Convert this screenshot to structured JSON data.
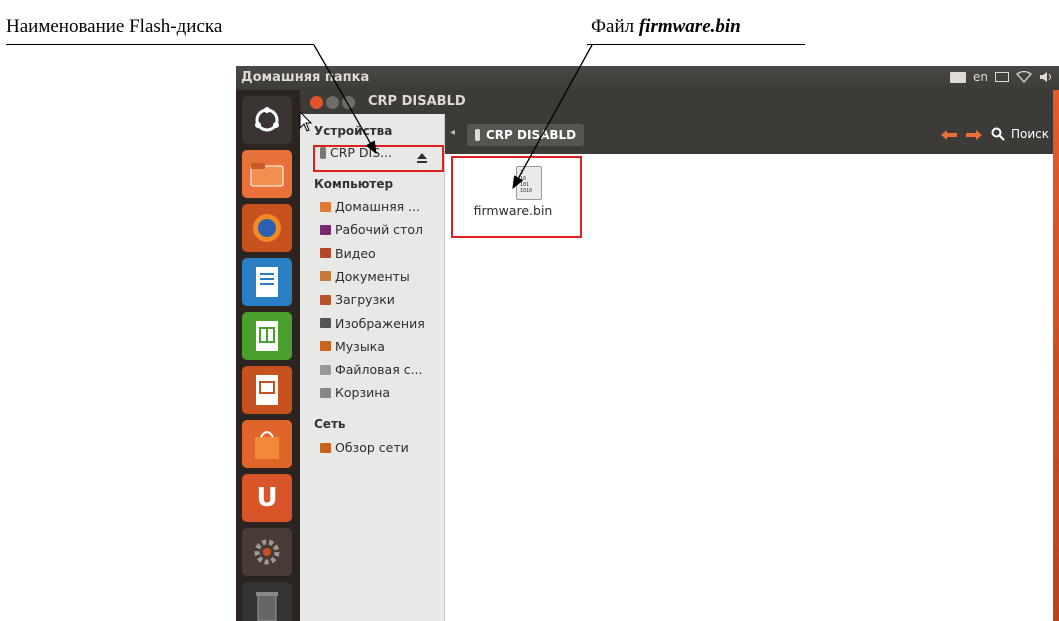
{
  "annotations": {
    "disk_label": "Наименование Flash-диска",
    "file_label_prefix": "Файл ",
    "file_label_name": "firmware.bin"
  },
  "panel": {
    "title": "Домашняя папка",
    "keyboard_layout": "en"
  },
  "window": {
    "title": "CRP DISABLD"
  },
  "sidebar": {
    "devices_header": "Устройства",
    "device_item": "CRP DIS...",
    "computer_header": "Компьютер",
    "computer_items": [
      {
        "label": "Домашняя ...",
        "icon": "home-folder-icon",
        "color": "#e07a3a"
      },
      {
        "label": "Рабочий стол",
        "icon": "desktop-icon",
        "color": "#7a2a6e"
      },
      {
        "label": "Видео",
        "icon": "video-icon",
        "color": "#b5452a"
      },
      {
        "label": "Документы",
        "icon": "documents-icon",
        "color": "#c87a3a"
      },
      {
        "label": "Загрузки",
        "icon": "downloads-icon",
        "color": "#b5542a"
      },
      {
        "label": "Изображения",
        "icon": "pictures-icon",
        "color": "#555555"
      },
      {
        "label": "Музыка",
        "icon": "music-icon",
        "color": "#c8641f"
      },
      {
        "label": "Файловая с...",
        "icon": "filesystem-icon",
        "color": "#999999"
      },
      {
        "label": "Корзина",
        "icon": "trash-icon",
        "color": "#888888"
      }
    ],
    "network_header": "Сеть",
    "network_items": [
      {
        "label": "Обзор сети",
        "icon": "network-icon",
        "color": "#c8641f"
      }
    ]
  },
  "toolbar": {
    "crumb": "CRP DISABLD",
    "back_icon": "back-arrow-icon",
    "forward_icon": "forward-arrow-icon",
    "search_label": "Поиск"
  },
  "content": {
    "file_name": "firmware.bin",
    "file_icon_text": "1\n10\n101\n1010"
  },
  "colors": {
    "highlight": "#e02020",
    "ubuntu_orange": "#e65b2a",
    "panel_dark": "#3c3b37"
  }
}
